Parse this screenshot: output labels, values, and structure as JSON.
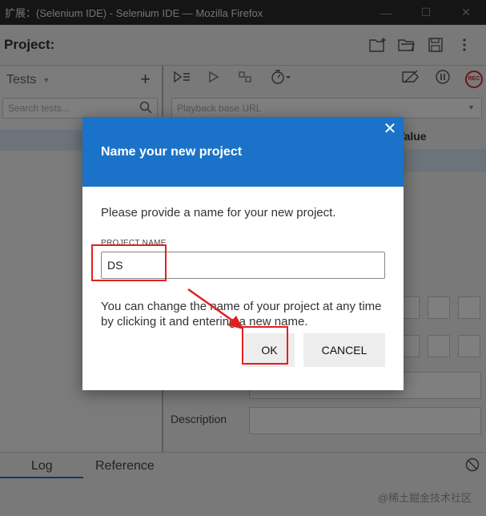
{
  "window": {
    "title": "扩展：(Selenium IDE) - Selenium IDE — Mozilla Firefox"
  },
  "project": {
    "label": "Project:"
  },
  "tests_panel": {
    "title": "Tests",
    "search_placeholder": "Search tests..."
  },
  "editor": {
    "url_placeholder": "Playback base URL",
    "value_column": "Value",
    "description_label": "Description"
  },
  "bottom": {
    "log_tab": "Log",
    "reference_tab": "Reference",
    "watermark": "@稀土掘金技术社区"
  },
  "dialog": {
    "title": "Name your new project",
    "prompt": "Please provide a name for your new project.",
    "field_label": "PROJECT NAME",
    "field_value": "DS",
    "hint": "You can change the name of your project at any time by clicking it and entering a new name.",
    "ok_label": "OK",
    "cancel_label": "CANCEL"
  },
  "colors": {
    "dialog_header": "#1a73c8",
    "highlight": "#e02020",
    "record": "#d32f2f"
  }
}
